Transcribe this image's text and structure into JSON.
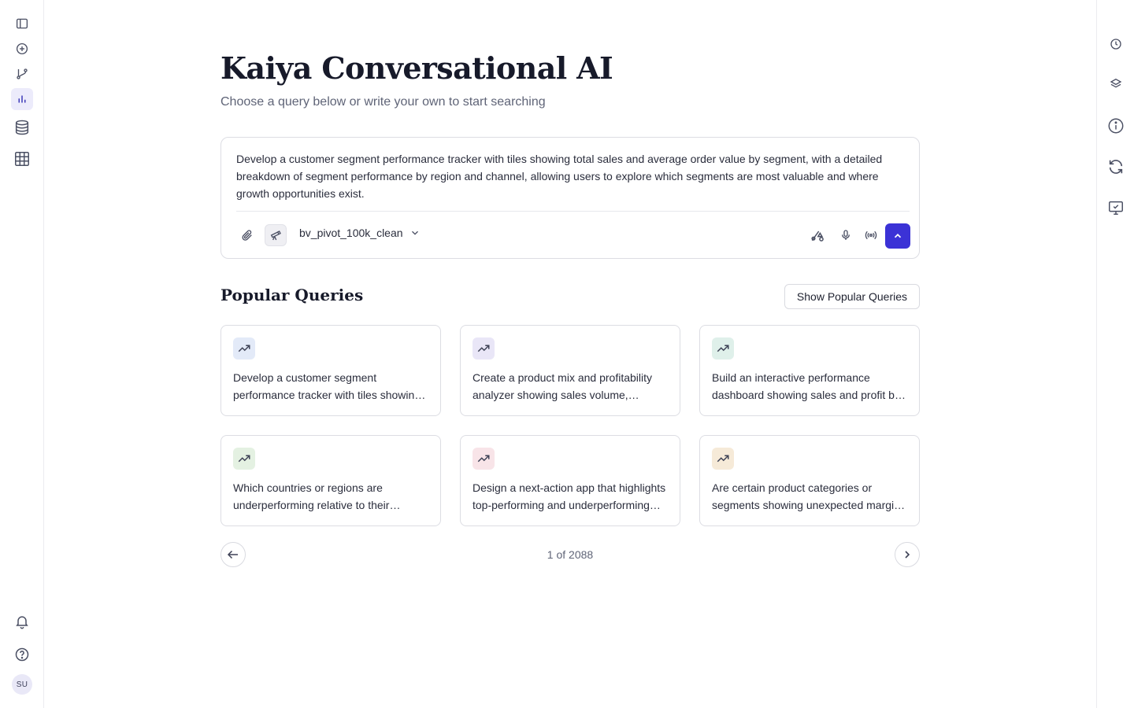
{
  "app": {
    "title": "Kaiya Conversational AI",
    "subtitle": "Choose a query below or write your own to start searching"
  },
  "left_nav": {
    "items": [
      {
        "name": "sidebar-toggle",
        "icon": "sidebar-toggle-icon",
        "active": false
      },
      {
        "name": "new-chat",
        "icon": "plus-circle-icon",
        "active": false
      },
      {
        "name": "branch",
        "icon": "git-branch-icon",
        "active": false
      },
      {
        "name": "analytics",
        "icon": "bar-chart-icon",
        "active": true
      },
      {
        "name": "database",
        "icon": "database-icon",
        "active": false
      },
      {
        "name": "table",
        "icon": "table-grid-icon",
        "active": false
      }
    ],
    "bottom": [
      {
        "name": "notifications",
        "icon": "bell-icon"
      },
      {
        "name": "help",
        "icon": "help-circle-icon"
      }
    ],
    "avatar_initials": "SU"
  },
  "right_rail": {
    "items": [
      "clock-icon",
      "layers-icon",
      "info-icon",
      "refresh-icon",
      "monitor-check-icon"
    ]
  },
  "composer": {
    "text": "Develop a customer segment performance tracker with tiles showing total sales and average order value by segment, with a detailed breakdown of segment performance by region and channel, allowing users to explore which segments are most valuable and where growth opportunities exist.",
    "dataset": "bv_pivot_100k_clean",
    "tools_left": [
      "paperclip-icon",
      "telescope-icon"
    ],
    "tools_right": [
      "scissors-shapes-icon",
      "microphone-icon",
      "broadcast-icon"
    ],
    "accent": "#3b32d6"
  },
  "popular": {
    "heading": "Popular Queries",
    "show_button": "Show Popular Queries",
    "cards": [
      {
        "text": "Develop a customer segment performance tracker with tiles showing total sales and average order value by segment",
        "icon_bg": "#e3eaf8"
      },
      {
        "text": "Create a product mix and profitability analyzer showing sales volume, revenue and margin",
        "icon_bg": "#e9e6f7"
      },
      {
        "text": "Build an interactive performance dashboard showing sales and profit by region",
        "icon_bg": "#dff0ea"
      },
      {
        "text": "Which countries or regions are underperforming relative to their historical trends?",
        "icon_bg": "#e4f1e2"
      },
      {
        "text": "Design a next-action app that highlights top-performing and underperforming products",
        "icon_bg": "#f8e4e8"
      },
      {
        "text": "Are certain product categories or segments showing unexpected margin changes?",
        "icon_bg": "#f6ead8"
      }
    ],
    "pager_label": "1 of 2088"
  }
}
